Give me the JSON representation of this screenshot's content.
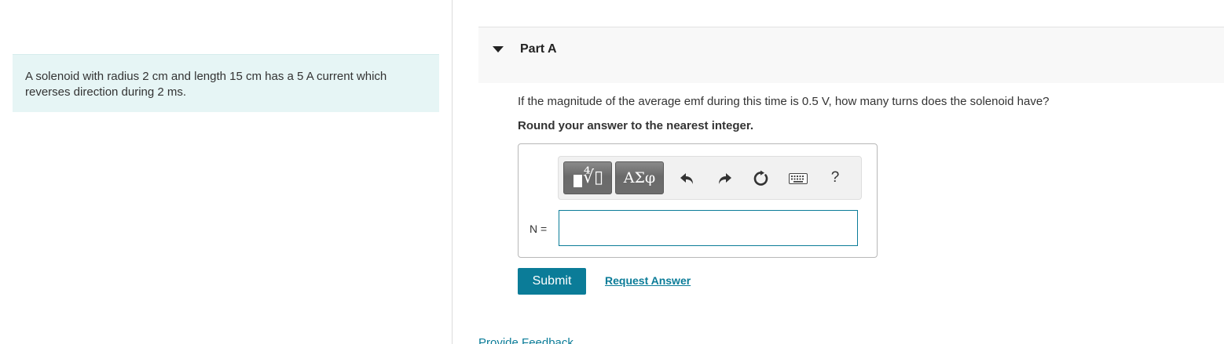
{
  "problem": {
    "text": "A solenoid with radius 2 cm and length 15 cm has a 5 A current which reverses direction during 2 ms."
  },
  "part": {
    "title": "Part A",
    "question": "If the magnitude of the average emf during this time is 0.5 V, how many turns does the solenoid have?",
    "instruction": "Round your answer to the nearest integer."
  },
  "toolbar": {
    "symbols_label": "ΑΣφ",
    "help_label": "?",
    "icons": [
      "templates-icon",
      "symbols-icon",
      "undo-icon",
      "redo-icon",
      "reset-icon",
      "keyboard-icon",
      "help-icon"
    ]
  },
  "answer": {
    "label": "N =",
    "value": ""
  },
  "actions": {
    "submit_label": "Submit",
    "request_label": "Request Answer",
    "feedback_label": "Provide Feedback"
  },
  "colors": {
    "accent": "#0b7c98",
    "problem_bg": "#e6f5f5",
    "toolbar_button": "#6d6d6d"
  }
}
